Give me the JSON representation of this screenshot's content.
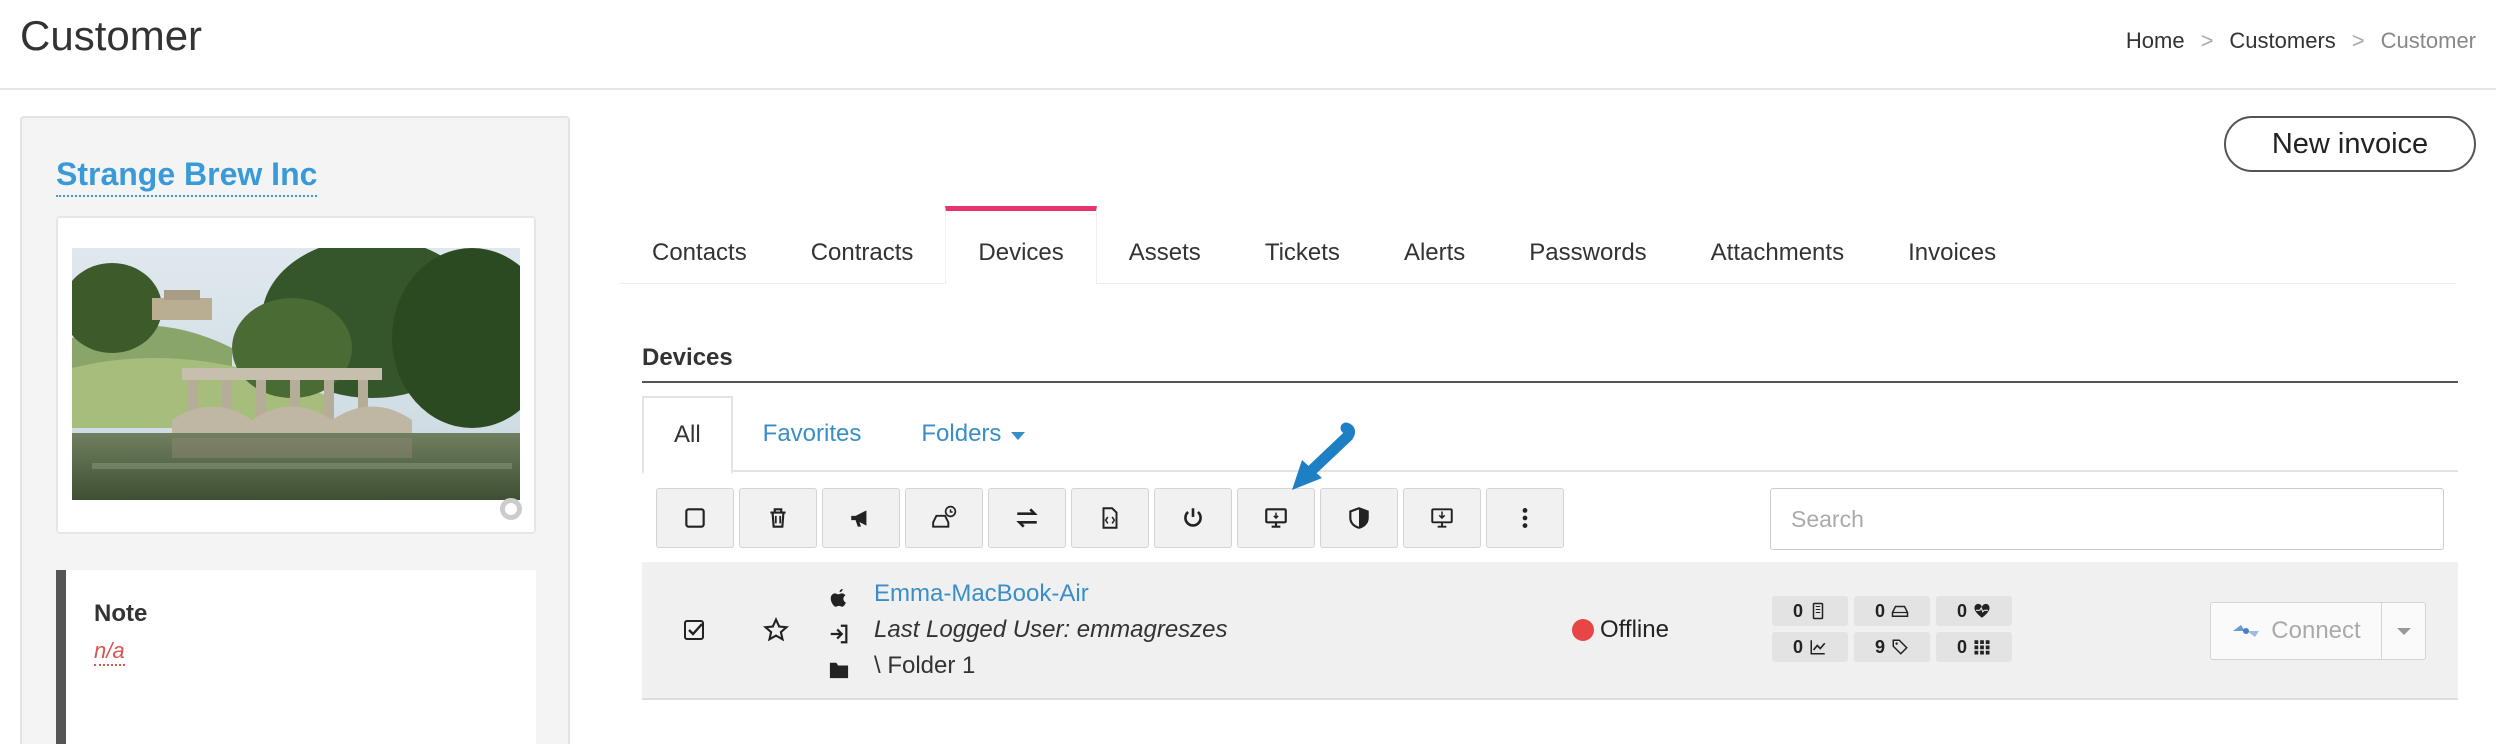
{
  "header": {
    "title": "Customer",
    "breadcrumb": [
      "Home",
      "Customers",
      "Customer"
    ],
    "separator": ">"
  },
  "customer": {
    "name": "Strange Brew Inc",
    "note_title": "Note",
    "note_value": "n/a"
  },
  "actions": {
    "new_invoice": "New invoice"
  },
  "tabs": [
    {
      "label": "Contacts"
    },
    {
      "label": "Contracts"
    },
    {
      "label": "Devices",
      "active": true
    },
    {
      "label": "Assets"
    },
    {
      "label": "Tickets"
    },
    {
      "label": "Alerts"
    },
    {
      "label": "Passwords"
    },
    {
      "label": "Attachments"
    },
    {
      "label": "Invoices"
    }
  ],
  "devices": {
    "section_title": "Devices",
    "subtabs": [
      "All",
      "Favorites",
      "Folders"
    ],
    "toolbar_icons": [
      "select-all-icon",
      "trash-icon",
      "megaphone-icon",
      "disk-schedule-icon",
      "transfer-icon",
      "script-icon",
      "power-icon",
      "remote-desktop-icon",
      "shield-icon",
      "download-install-icon",
      "more-vertical-icon"
    ],
    "search_placeholder": "Search",
    "rows": [
      {
        "name": "Emma-MacBook-Air",
        "last_user": "Last Logged User: emmagreszes",
        "folder": "\\ Folder 1",
        "status": "Offline",
        "status_color": "#e84646",
        "metrics": [
          {
            "value": "0",
            "icon": "device-icon"
          },
          {
            "value": "0",
            "icon": "disk-icon"
          },
          {
            "value": "0",
            "icon": "health-icon"
          },
          {
            "value": "0",
            "icon": "chart-icon"
          },
          {
            "value": "9",
            "icon": "tag-icon"
          },
          {
            "value": "0",
            "icon": "apps-icon"
          }
        ],
        "connect_label": "Connect"
      }
    ]
  },
  "colors": {
    "accent": "#3a9ad9",
    "active_tab": "#e8336d",
    "offline": "#e84646"
  }
}
